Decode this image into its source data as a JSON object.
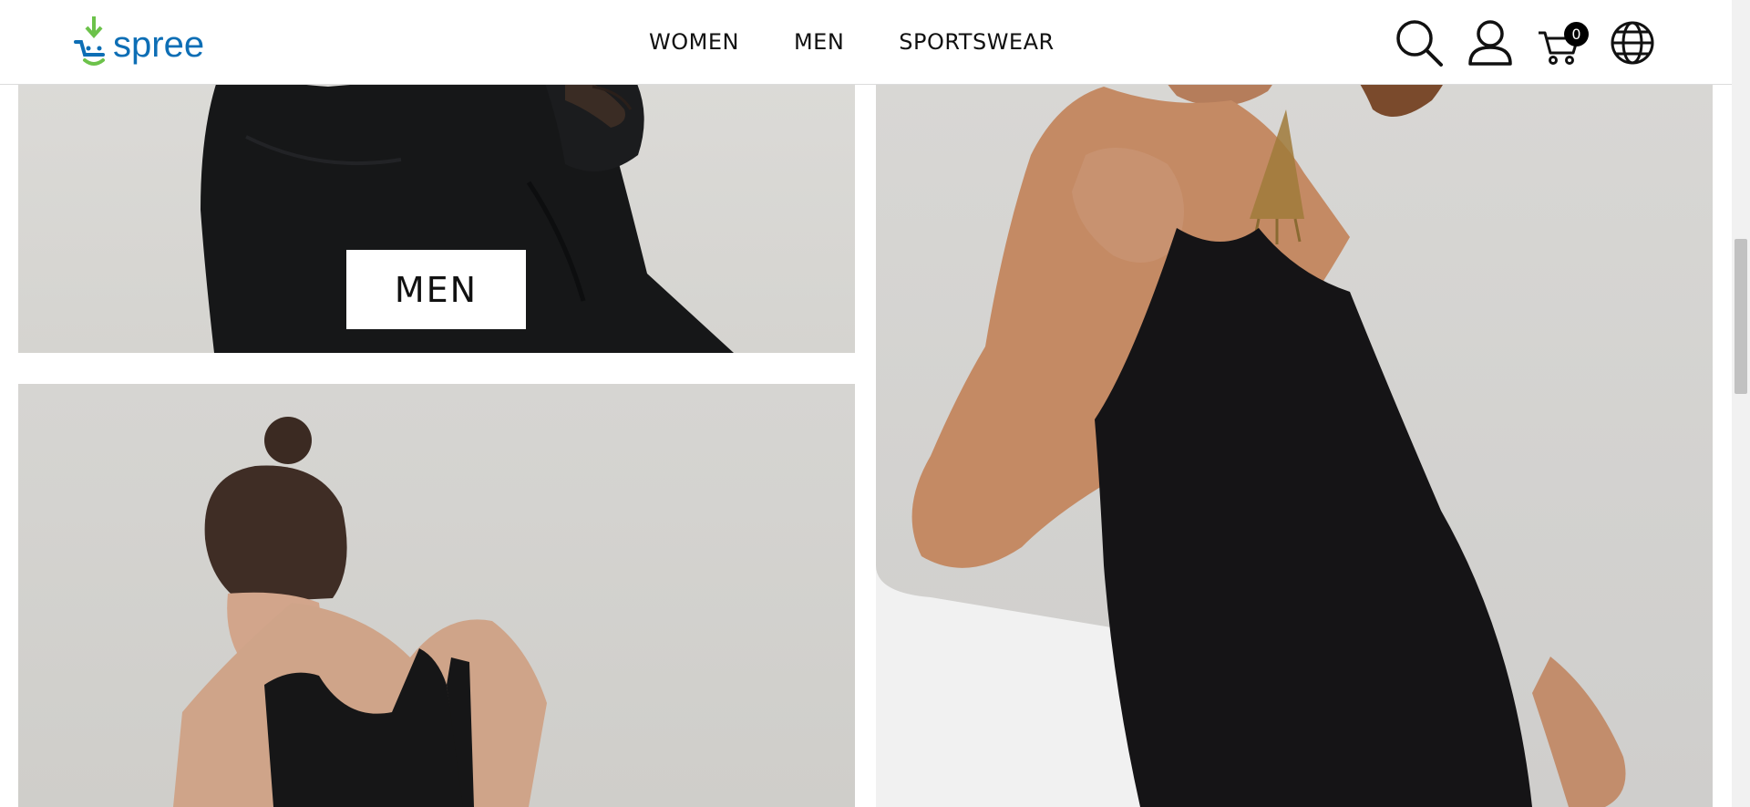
{
  "brand": {
    "logo_text": "spree",
    "logo_color": "#0d6eb5",
    "logo_accent": "#6cc24a"
  },
  "nav": {
    "items": [
      {
        "label": "WOMEN"
      },
      {
        "label": "MEN"
      },
      {
        "label": "SPORTSWEAR"
      }
    ]
  },
  "header_icons": {
    "search": "search-icon",
    "account": "user-icon",
    "cart": "cart-icon",
    "cart_count": "0",
    "language": "globe-icon"
  },
  "tiles": {
    "men": {
      "label": "MEN"
    },
    "sportswear": {
      "label": ""
    },
    "women": {
      "label": ""
    }
  },
  "colors": {
    "header_bg": "#ffffff",
    "text": "#111111",
    "badge_bg": "#000000"
  }
}
